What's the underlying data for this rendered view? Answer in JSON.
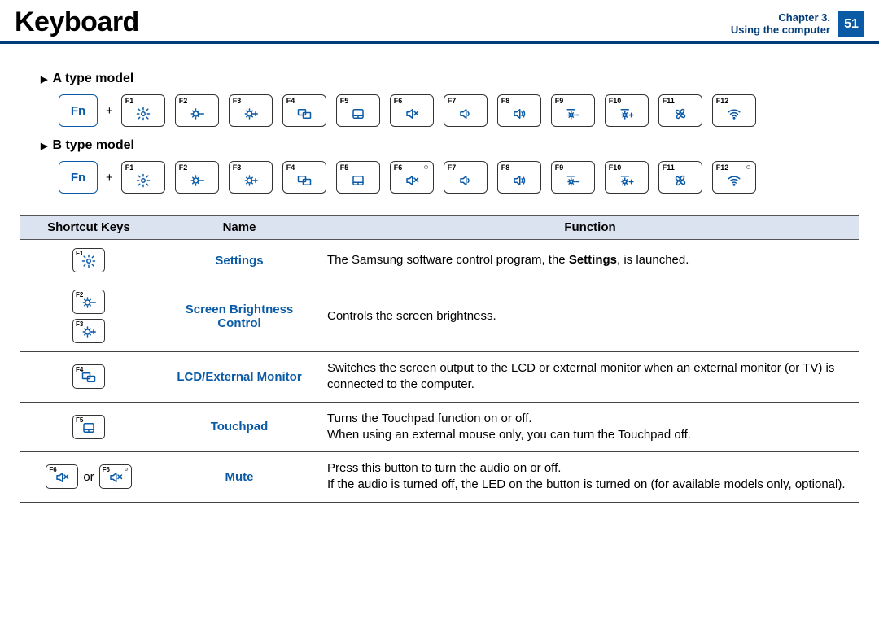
{
  "header": {
    "title": "Keyboard",
    "chapter_line1": "Chapter 3.",
    "chapter_line2": "Using the computer",
    "page_number": "51"
  },
  "models": {
    "a_label": "A type model",
    "b_label": "B type model",
    "fn_label": "Fn",
    "plus": "+",
    "or": "or"
  },
  "keys": [
    {
      "num": "F1",
      "icon": "gear"
    },
    {
      "num": "F2",
      "icon": "bright-down"
    },
    {
      "num": "F3",
      "icon": "bright-up"
    },
    {
      "num": "F4",
      "icon": "display"
    },
    {
      "num": "F5",
      "icon": "touchpad"
    },
    {
      "num": "F6",
      "icon": "mute"
    },
    {
      "num": "F7",
      "icon": "vol-down"
    },
    {
      "num": "F8",
      "icon": "vol-up"
    },
    {
      "num": "F9",
      "icon": "kbd-down"
    },
    {
      "num": "F10",
      "icon": "kbd-up"
    },
    {
      "num": "F11",
      "icon": "fan"
    },
    {
      "num": "F12",
      "icon": "wifi"
    }
  ],
  "b_type_leds": [
    "F6",
    "F12"
  ],
  "table": {
    "headers": {
      "shortcut": "Shortcut Keys",
      "name": "Name",
      "function": "Function"
    },
    "rows": [
      {
        "keys": [
          {
            "num": "F1",
            "icon": "gear"
          }
        ],
        "name": "Settings",
        "function_pre": "The Samsung software control program, the ",
        "function_bold": "Settings",
        "function_post": ", is launched."
      },
      {
        "keys": [
          {
            "num": "F2",
            "icon": "bright-down"
          },
          {
            "num": "F3",
            "icon": "bright-up"
          }
        ],
        "stack": true,
        "name": "Screen Brightness Control",
        "function": "Controls the screen brightness."
      },
      {
        "keys": [
          {
            "num": "F4",
            "icon": "display"
          }
        ],
        "name": "LCD/External Monitor",
        "function": "Switches the screen output to the LCD or external monitor when an external monitor (or TV) is connected to the computer."
      },
      {
        "keys": [
          {
            "num": "F5",
            "icon": "touchpad"
          }
        ],
        "name": "Touchpad",
        "function": "Turns the Touchpad function on or off.\nWhen using an external mouse only, you can turn the Touchpad off."
      },
      {
        "keys_or": [
          {
            "num": "F6",
            "icon": "mute"
          },
          {
            "num": "F6",
            "icon": "mute",
            "led": true
          }
        ],
        "name": "Mute",
        "function": "Press this button to turn the audio on or off.\nIf the audio is turned off, the LED on the button is turned on (for available models only, optional)."
      }
    ]
  }
}
